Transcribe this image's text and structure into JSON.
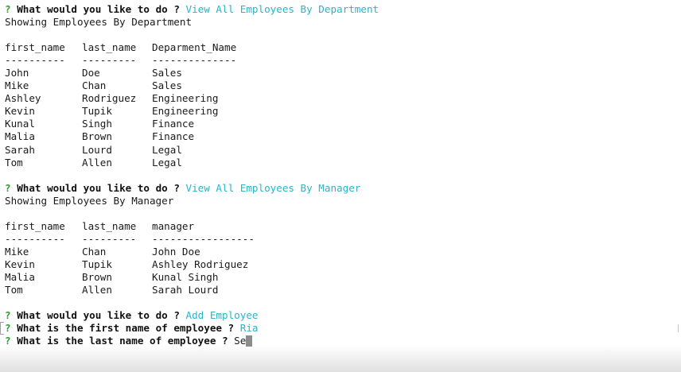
{
  "terminal": {
    "prompt_symbol": "?",
    "question": "What would you like to do ?",
    "colors": {
      "prompt": "#2aa02a",
      "answer": "#2bb3c7",
      "text": "#1a1a1a",
      "cursor": "#8c8c8c"
    },
    "block1": {
      "answer": "View All Employees By Department",
      "status": "Showing Employees By Department",
      "headers": [
        "first_name",
        "last_name",
        "Deparment_Name"
      ],
      "separators": [
        "----------",
        "---------",
        "--------------"
      ],
      "rows": [
        [
          "John",
          "Doe",
          "Sales"
        ],
        [
          "Mike",
          "Chan",
          "Sales"
        ],
        [
          "Ashley",
          "Rodriguez",
          "Engineering"
        ],
        [
          "Kevin",
          "Tupik",
          "Engineering"
        ],
        [
          "Kunal",
          "Singh",
          "Finance"
        ],
        [
          "Malia",
          "Brown",
          "Finance"
        ],
        [
          "Sarah",
          "Lourd",
          "Legal"
        ],
        [
          "Tom",
          "Allen",
          "Legal"
        ]
      ]
    },
    "block2": {
      "answer": "View All Employees By Manager",
      "status": "Showing Employees By Manager",
      "headers": [
        "first_name",
        "last_name",
        "manager"
      ],
      "separators": [
        "----------",
        "---------",
        "-----------------"
      ],
      "rows": [
        [
          "Mike",
          "Chan",
          "John Doe"
        ],
        [
          "Kevin",
          "Tupik",
          "Ashley Rodriguez"
        ],
        [
          "Malia",
          "Brown",
          "Kunal Singh"
        ],
        [
          "Tom",
          "Allen",
          "Sarah Lourd"
        ]
      ]
    },
    "block3": {
      "answer": "Add Employee",
      "first_name_question": "What is the first name of employee ?",
      "first_name_answer": "Ria",
      "last_name_question": "What is the last name of employee ?",
      "last_name_input": "Se"
    }
  }
}
